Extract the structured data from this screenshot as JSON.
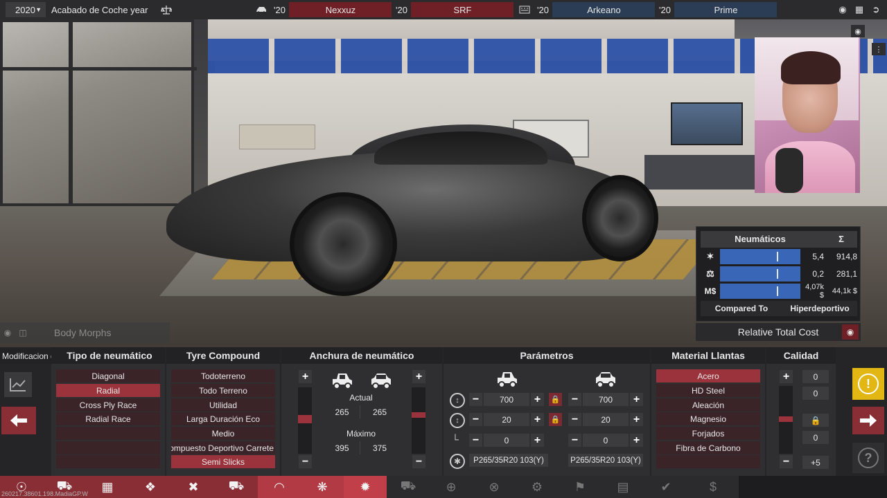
{
  "topbar": {
    "year": "2020",
    "title": "Acabado de Coche year",
    "competitors": [
      {
        "year": "'20",
        "name": "Nexxuz"
      },
      {
        "year": "'20",
        "name": "SRF"
      },
      {
        "year": "'20",
        "name": "Arkeano"
      },
      {
        "year": "'20",
        "name": "Prime"
      }
    ]
  },
  "scene": {
    "body_morphs_label": "Body Morphs"
  },
  "stats": {
    "header": "Neumáticos",
    "sigma": "Σ",
    "rows": [
      {
        "icon": "performance-icon",
        "value": "5,4",
        "total": "914,8",
        "level": 0.71
      },
      {
        "icon": "weight-icon",
        "value": "0,2",
        "total": "281,1",
        "level": 0.71
      },
      {
        "icon": "cost-icon",
        "label": "M$",
        "value": "4,07k $",
        "total": "44,1k $",
        "level": 0.71
      }
    ],
    "compared_to_label": "Compared To",
    "compared_to_value": "Hiperdeportivo",
    "relative_total_cost": "Relative Total Cost"
  },
  "panel": {
    "tooltip_label": "Modificacion de Tip",
    "tyre_type": {
      "header": "Tipo de neumático",
      "options": [
        "Diagonal",
        "Radial",
        "Cross Ply Race",
        "Radial Race"
      ],
      "selected": "Radial"
    },
    "tyre_compound": {
      "header": "Tyre Compound",
      "options": [
        "Todoterreno",
        "Todo Terreno",
        "Utilidad",
        "Larga Duración Eco",
        "Medio",
        "ompuesto Deportivo Carrete",
        "Semi Slicks"
      ],
      "selected": "Semi Slicks"
    },
    "width": {
      "header": "Anchura de neumático",
      "actual_label": "Actual",
      "actual_front": "265",
      "actual_rear": "265",
      "max_label": "Máximo",
      "max_front": "395",
      "max_rear": "375"
    },
    "params": {
      "header": "Parámetros",
      "front": {
        "profile": "700",
        "offset": "20",
        "third": "0",
        "spec": "P265/35R20 103(Y)"
      },
      "rear": {
        "profile": "700",
        "offset": "20",
        "third": "0",
        "spec": "P265/35R20 103(Y)"
      }
    },
    "rim_material": {
      "header": "Material Llantas",
      "options": [
        "Acero",
        "HD Steel",
        "Aleación",
        "Magnesio",
        "Forjados",
        "Fibra de Carbono"
      ],
      "selected": "Acero"
    },
    "quality": {
      "header": "Calidad",
      "values": [
        "0",
        "0",
        "0"
      ],
      "bonus": "+5"
    }
  },
  "watermark": "260217.38601.198.MadiaGP.W",
  "colors": {
    "accent_red": "#9a333c",
    "accent_blue": "#3a66b8",
    "warning_yellow": "#e2b714"
  }
}
